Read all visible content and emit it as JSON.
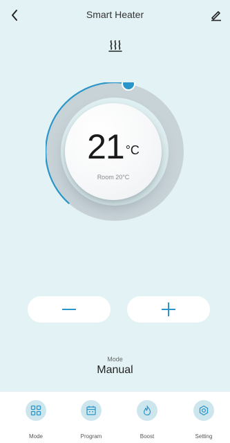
{
  "header": {
    "title": "Smart Heater",
    "back_icon": "chevron-left-icon",
    "edit_icon": "pencil-icon"
  },
  "heater_icon": "heat-waves-icon",
  "thermostat": {
    "target_temp": "21",
    "unit": "°C",
    "room_label": "Room 20°C",
    "colors": {
      "ring": "#c8d3d8",
      "arc": "#2a95c8",
      "knob": "#2a95c8"
    }
  },
  "controls": {
    "minus_icon": "minus-icon",
    "plus_icon": "plus-icon"
  },
  "mode": {
    "caption": "Mode",
    "value": "Manual"
  },
  "nav": {
    "items": [
      {
        "label": "Mode",
        "icon": "grid-icon"
      },
      {
        "label": "Program",
        "icon": "calendar-icon"
      },
      {
        "label": "Boost",
        "icon": "flame-icon"
      },
      {
        "label": "Setting",
        "icon": "gear-icon"
      }
    ]
  }
}
